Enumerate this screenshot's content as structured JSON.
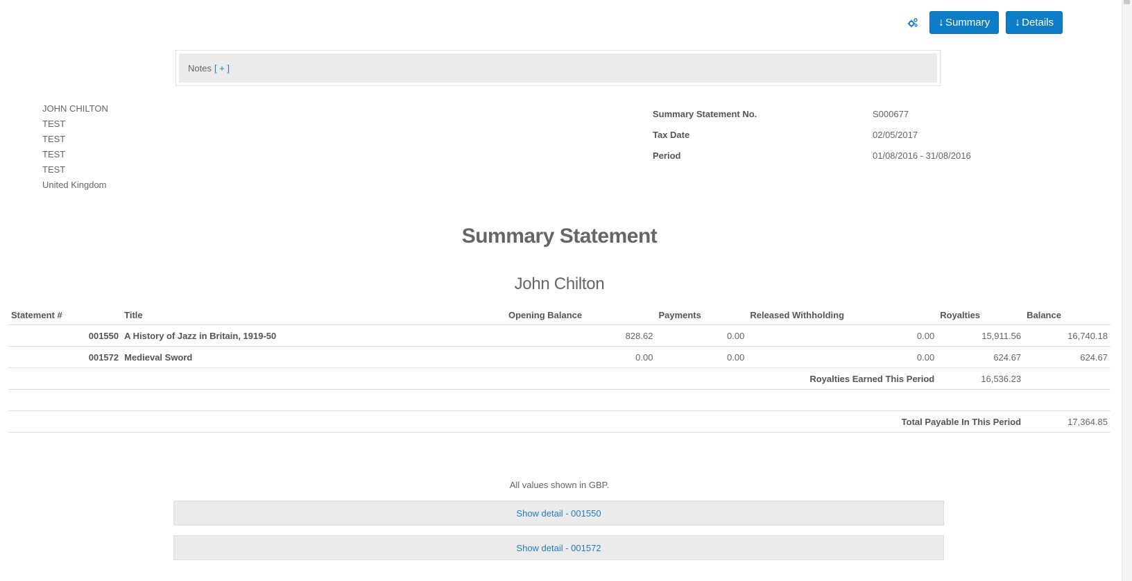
{
  "toolbar": {
    "settings_icon": "gears-icon",
    "summary_label": "Summary",
    "details_label": "Details",
    "download_arrow": "↓"
  },
  "notes": {
    "label": "Notes",
    "toggle": "[ + ]"
  },
  "address": [
    "JOHN CHILTON",
    "TEST",
    "TEST",
    "TEST",
    "TEST",
    "United Kingdom"
  ],
  "meta": {
    "statement_no_label": "Summary Statement No.",
    "statement_no": "S000677",
    "tax_date_label": "Tax Date",
    "tax_date": "02/05/2017",
    "period_label": "Period",
    "period": "01/08/2016 - 31/08/2016"
  },
  "heading": {
    "title": "Summary Statement",
    "name": "John Chilton"
  },
  "table": {
    "headers": [
      "Statement #",
      "Title",
      "Opening Balance",
      "Payments",
      "Released Withholding",
      "Royalties",
      "Balance"
    ],
    "rows": [
      {
        "statement": "001550",
        "title": "A History of Jazz in Britain, 1919-50",
        "opening": "828.62",
        "payments": "0.00",
        "withholding": "0.00",
        "royalties": "15,911.56",
        "balance": "16,740.18"
      },
      {
        "statement": "001572",
        "title": "Medieval Sword",
        "opening": "0.00",
        "payments": "0.00",
        "withholding": "0.00",
        "royalties": "624.67",
        "balance": "624.67"
      }
    ],
    "royalties_earned_label": "Royalties Earned This Period",
    "royalties_earned": "16,536.23",
    "total_payable_label": "Total Payable In This Period",
    "total_payable": "17,364.85"
  },
  "footer": {
    "currency_note": "All values shown in GBP.",
    "detail_links": [
      "Show detail - 001550",
      "Show detail - 001572"
    ]
  },
  "colors": {
    "accent": "#0d7dc7",
    "link": "#1f7bc4",
    "text": "#666666",
    "panel": "#ebebeb"
  }
}
